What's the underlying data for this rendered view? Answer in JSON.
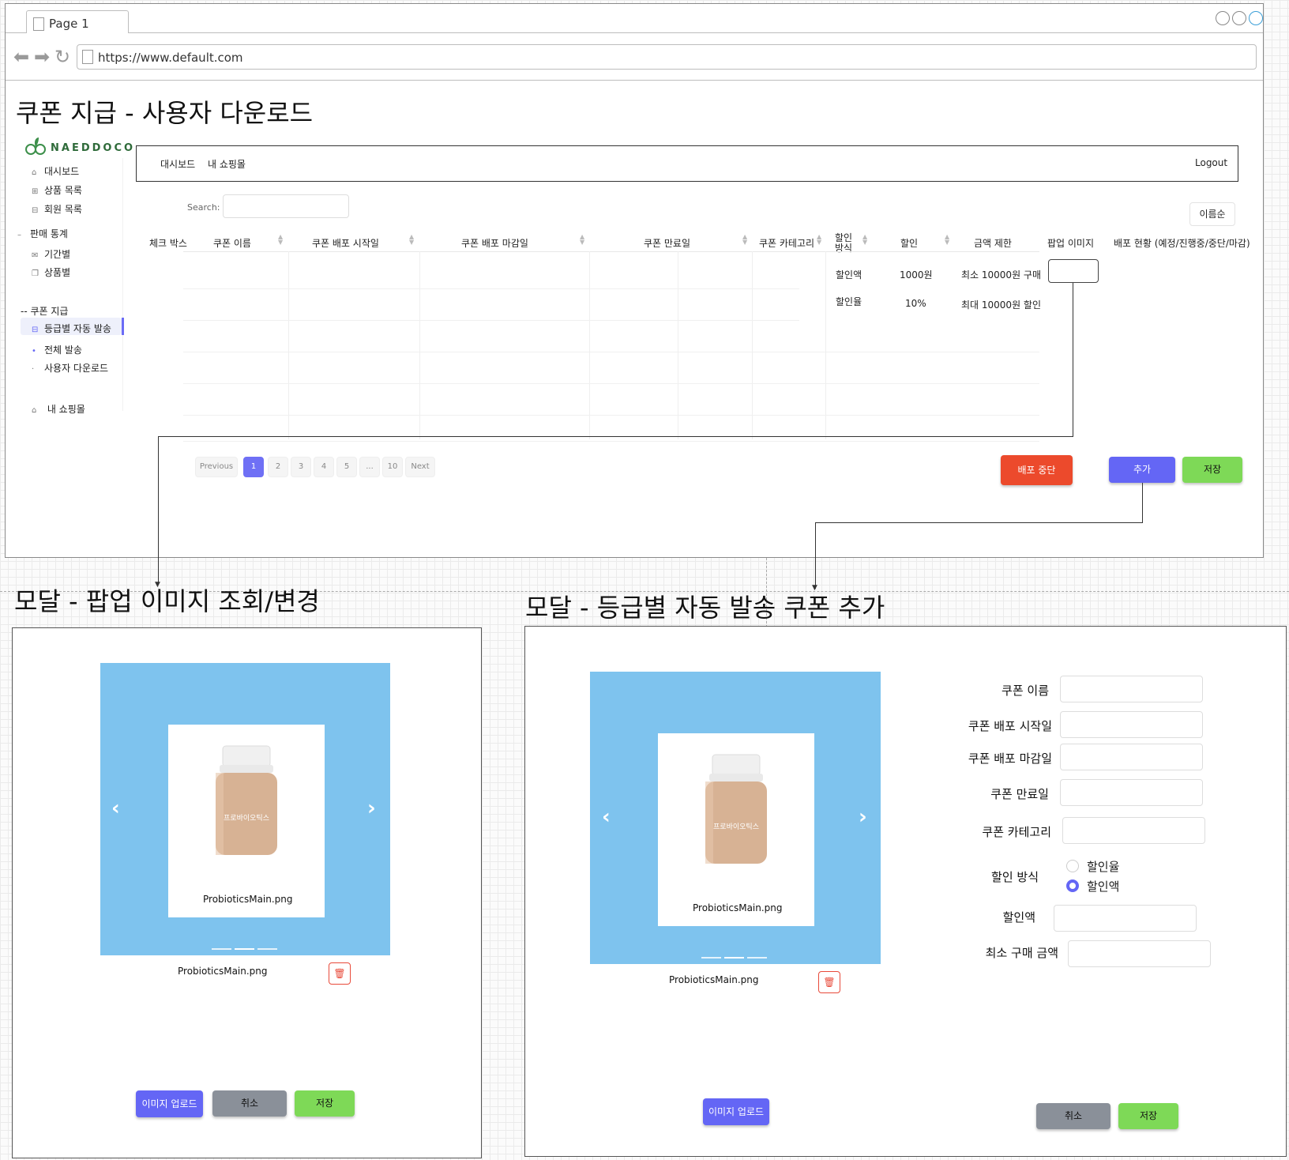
{
  "browser": {
    "tab_label": "Page 1",
    "url": "https://www.default.com"
  },
  "page_title": "쿠폰 지급 - 사용자 다운로드",
  "logo_text": "NAEDDOCO",
  "sidebar": {
    "items": [
      {
        "icon": "home-icon",
        "label": "대시보드"
      },
      {
        "icon": "grid-icon",
        "label": "상품 목록"
      },
      {
        "icon": "users-icon",
        "label": "회원 목록"
      },
      {
        "icon": "dash-icon",
        "label": "판매 통계"
      },
      {
        "icon": "mail-icon",
        "label": "기간별"
      },
      {
        "icon": "copy-icon",
        "label": "상품별"
      },
      {
        "icon": "dash-icon",
        "label": "-- 쿠폰 지급"
      },
      {
        "icon": "list-icon",
        "label": "등급별 자동 발송"
      },
      {
        "icon": "dot-icon",
        "label": "전체 발송"
      },
      {
        "icon": "dot-icon",
        "label": "사용자 다운로드"
      },
      {
        "icon": "lock-icon",
        "label": "내 쇼핑몰"
      }
    ]
  },
  "topnav": {
    "dashboard": "대시보드",
    "myshop": "내 쇼핑몰",
    "logout": "Logout"
  },
  "search": {
    "label": "Search:",
    "placeholder": ""
  },
  "sort": {
    "selected": "이름순"
  },
  "table": {
    "headers": [
      "체크 박스",
      "쿠폰 이름",
      "쿠폰 배포 시작일",
      "쿠폰 배포 마감일",
      "쿠폰 만료일",
      "쿠폰 카테고리",
      "할인 방식",
      "할인",
      "금액 제한",
      "팝업 이미지",
      "배포 현황 (예정/진행중/중단/마감)"
    ],
    "rows": [
      {
        "method": "할인액",
        "discount": "1000원",
        "limit": "최소 10000원 구매"
      },
      {
        "method": "할인율",
        "discount": "10%",
        "limit": "최대 10000원 할인"
      }
    ]
  },
  "pagination": {
    "prev": "Previous",
    "pages": [
      "1",
      "2",
      "3",
      "4",
      "5",
      "...",
      "10"
    ],
    "next": "Next",
    "current": "1"
  },
  "buttons": {
    "stop": "배포 중단",
    "add": "추가",
    "save": "저장"
  },
  "modal_image": {
    "title": "모달 - 팝업 이미지 조회/변경",
    "card_filename": "ProbioticsMain.png",
    "filename": "ProbioticsMain.png",
    "upload": "이미지 업로드",
    "cancel": "취소",
    "save": "저장"
  },
  "modal_coupon": {
    "title": "모달 - 등급별 자동 발송 쿠폰 추가",
    "card_filename": "ProbioticsMain.png",
    "filename": "ProbioticsMain.png",
    "upload": "이미지 업로드",
    "cancel": "취소",
    "save": "저장",
    "fields": {
      "name": "쿠폰 이름",
      "start": "쿠폰 배포 시작일",
      "end": "쿠폰 배포 마감일",
      "expire": "쿠폰 만료일",
      "category": "쿠폰 카테고리",
      "method": "할인 방식",
      "amount": "할인액",
      "min_purchase": "최소 구매 금액"
    },
    "method_options": {
      "rate": "할인율",
      "amount": "할인액",
      "selected": "할인액"
    }
  },
  "product_label": "프로바이오틱스",
  "colors": {
    "accent": "#6466f5",
    "danger": "#ec4a2c",
    "success": "#7ed957",
    "neutral": "#8a9099",
    "carousel_bg": "#7ec3ee"
  }
}
